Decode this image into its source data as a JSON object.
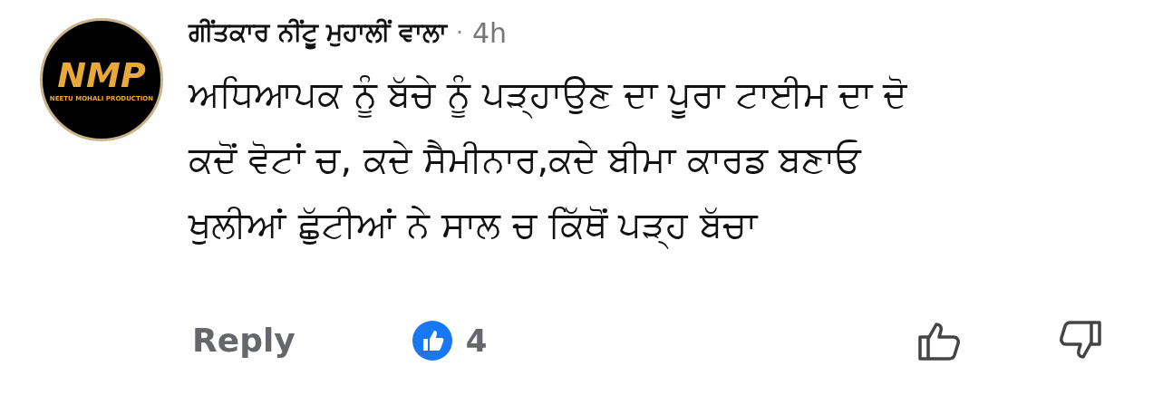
{
  "comment": {
    "avatar": {
      "logo_mark": "NMP",
      "logo_caption": "NEETU MOHALI PRODUCTION"
    },
    "author": "ਗੀਂਤਕਾਰ ਨੀਂਟੂ ਮੁਹਾਲੀਂ ਵਾਲਾ",
    "separator": "·",
    "time": "4h",
    "lines": [
      "ਅਧਿਆਪਕ ਨੂੰ ਬੱਚੇ ਨੂੰ ਪੜ੍ਹਾਉਣ ਦਾ ਪੂਰਾ ਟਾਈਮ ਦਾ ਦੋ",
      "ਕਦੋਂ ਵੋਟਾਂ ਚ, ਕਦੇ ਸੈਮੀਨਾਰ,ਕਦੇ ਬੀਮਾ ਕਾਰਡ ਬਣਾਓ",
      "ਖੁਲੀਆਂ ਛੁੱਟੀਆਂ ਨੇ ਸਾਲ ਚ ਕਿੱਥੋਂ ਪੜ੍ਹ ਬੱਚਾ"
    ],
    "reply": "Reply",
    "like_count": "4"
  }
}
